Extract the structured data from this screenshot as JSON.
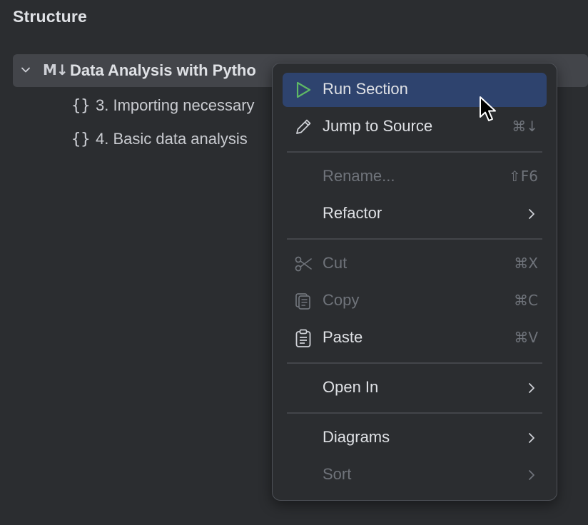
{
  "panel": {
    "title": "Structure"
  },
  "tree": {
    "root": {
      "icon": "markdown-icon",
      "icon_text": "M↓",
      "label": "Data Analysis with Pytho"
    },
    "items": [
      {
        "icon": "braces-icon",
        "icon_text": "{}",
        "label": "3. Importing necessary"
      },
      {
        "icon": "braces-icon",
        "icon_text": "{}",
        "label": "4. Basic data analysis"
      }
    ]
  },
  "context_menu": {
    "items": [
      {
        "label": "Run Section",
        "icon": "run-icon",
        "shortcut": "",
        "enabled": true,
        "selected": true,
        "submenu": false
      },
      {
        "label": "Jump to Source",
        "icon": "pencil-icon",
        "shortcut": "⌘↓",
        "enabled": true,
        "selected": false,
        "submenu": false
      },
      {
        "label": "Rename...",
        "icon": "",
        "shortcut": "⇧F6",
        "enabled": false,
        "selected": false,
        "submenu": false
      },
      {
        "label": "Refactor",
        "icon": "",
        "shortcut": "",
        "enabled": true,
        "selected": false,
        "submenu": true
      },
      {
        "label": "Cut",
        "icon": "scissors-icon",
        "shortcut": "⌘X",
        "enabled": false,
        "selected": false,
        "submenu": false
      },
      {
        "label": "Copy",
        "icon": "copy-icon",
        "shortcut": "⌘C",
        "enabled": false,
        "selected": false,
        "submenu": false
      },
      {
        "label": "Paste",
        "icon": "clipboard-icon",
        "shortcut": "⌘V",
        "enabled": true,
        "selected": false,
        "submenu": false
      },
      {
        "label": "Open In",
        "icon": "",
        "shortcut": "",
        "enabled": true,
        "selected": false,
        "submenu": true
      },
      {
        "label": "Diagrams",
        "icon": "",
        "shortcut": "",
        "enabled": true,
        "selected": false,
        "submenu": true
      },
      {
        "label": "Sort",
        "icon": "",
        "shortcut": "",
        "enabled": false,
        "selected": false,
        "submenu": true
      }
    ]
  },
  "colors": {
    "background": "#2b2d30",
    "selection": "#2e436e",
    "run_green": "#5fb865",
    "text": "#dfe1e5",
    "disabled_text": "#6f737a"
  }
}
